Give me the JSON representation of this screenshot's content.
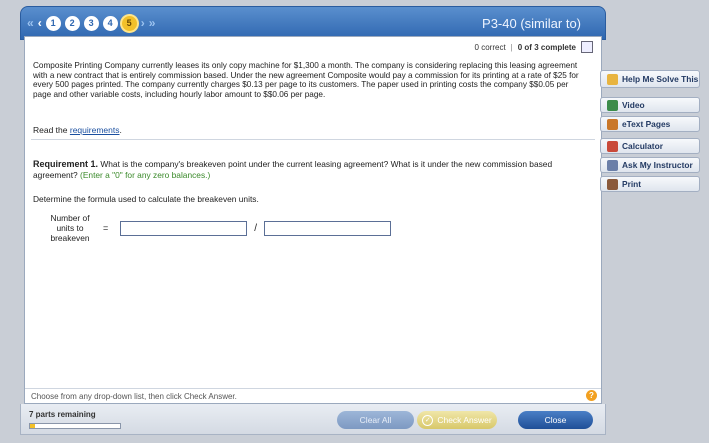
{
  "header": {
    "title": "P3-40 (similar to)",
    "steps": [
      "1",
      "2",
      "3",
      "4",
      "5"
    ],
    "active_step": "5"
  },
  "status": {
    "correct": "0 correct",
    "complete": "0 of 3 complete"
  },
  "problem": {
    "intro": "Composite Printing Company currently leases its only copy machine for $1,300 a month. The company is considering replacing this leasing agreement with a new contract that is entirely commission based. Under the new agreement Composite would pay a commission for its printing at a rate of $25 for every 500 pages printed. The company currently charges $0.13 per page to its customers. The paper used in printing costs the company $$0.05 per page and other variable costs, including hourly labor amount to $$0.06 per page.",
    "read_prefix": "Read the ",
    "read_link": "requirements",
    "read_suffix": ".",
    "requirement_label": "Requirement 1.",
    "requirement_text": " What is the company's breakeven point under the current leasing agreement? What is it under the new commission based agreement? ",
    "requirement_hint": "(Enter a \"0\" for any zero balances.)",
    "formula_prompt": "Determine the formula used to calculate the breakeven units.",
    "formula_label": "Number of units to breakeven",
    "formula_eq": "=",
    "formula_slash": "/",
    "numerator_value": "",
    "denominator_value": ""
  },
  "footer": {
    "hint": "Choose from any drop-down list, then click Check Answer.",
    "help_symbol": "?"
  },
  "bottombar": {
    "parts_remaining": "7 parts remaining",
    "progress": 0.05,
    "clear_all": "Clear All",
    "check_answer": "Check Answer",
    "close": "Close"
  },
  "tools": {
    "help_me": "Help Me Solve This",
    "video": "Video",
    "etext": "eText Pages",
    "calculator": "Calculator",
    "ask": "Ask My Instructor",
    "print": "Print"
  },
  "colors": {
    "header_blue": "#2f67b0",
    "active_step": "#f2c029",
    "hint_green": "#3a8a2a",
    "close_blue": "#1f4f97"
  }
}
